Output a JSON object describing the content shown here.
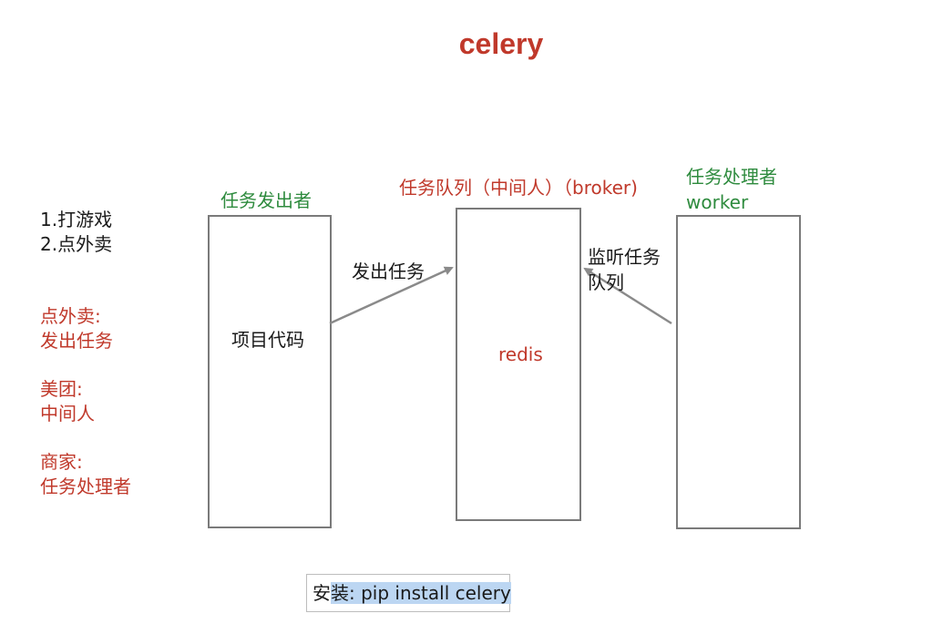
{
  "title": "celery",
  "list_items": [
    "1.打游戏",
    "2.点外卖"
  ],
  "analogies": [
    {
      "label": "点外卖:",
      "value": "发出任务"
    },
    {
      "label": "美团:",
      "value": "中间人"
    },
    {
      "label": "商家:",
      "value": "任务处理者"
    }
  ],
  "producer": {
    "heading": "任务发出者",
    "body": "项目代码"
  },
  "broker": {
    "heading": "任务队列（中间人）（broker)",
    "body": "redis"
  },
  "worker": {
    "heading_line1": "任务处理者",
    "heading_line2": "worker"
  },
  "arrows": {
    "send": "发出任务",
    "listen_line1": "监听任务",
    "listen_line2": "队列"
  },
  "install": {
    "prefix": "安",
    "highlighted": "装: pip install celery"
  },
  "colors": {
    "title": "#c0392b",
    "green": "#2e8b3e",
    "red": "#c0392b",
    "box_border": "#7a7a7a",
    "highlight": "#bcd6f2"
  }
}
